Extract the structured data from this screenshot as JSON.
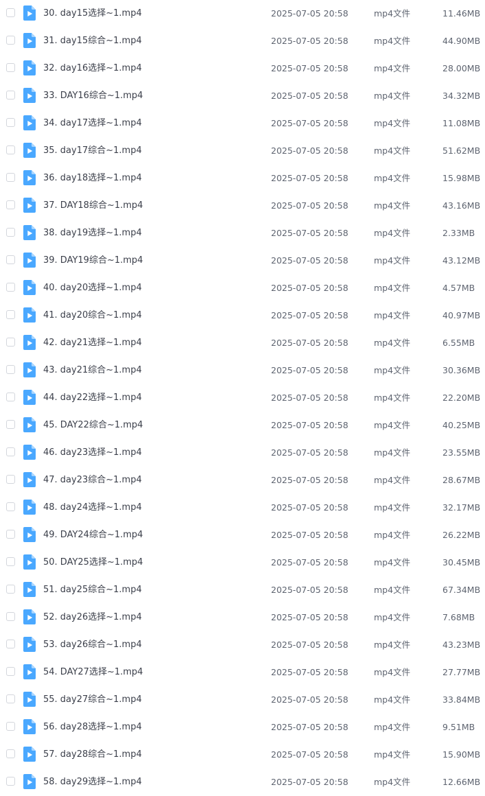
{
  "file_list": {
    "icon": "video-file-icon",
    "icon_color": "#4aa8ff",
    "rows": [
      {
        "name": "30. day15选择~1.mp4",
        "date": "2025-07-05 20:58",
        "type": "mp4文件",
        "size": "11.46MB"
      },
      {
        "name": "31. day15综合~1.mp4",
        "date": "2025-07-05 20:58",
        "type": "mp4文件",
        "size": "44.90MB"
      },
      {
        "name": "32. day16选择~1.mp4",
        "date": "2025-07-05 20:58",
        "type": "mp4文件",
        "size": "28.00MB"
      },
      {
        "name": "33. DAY16综合~1.mp4",
        "date": "2025-07-05 20:58",
        "type": "mp4文件",
        "size": "34.32MB"
      },
      {
        "name": "34. day17选择~1.mp4",
        "date": "2025-07-05 20:58",
        "type": "mp4文件",
        "size": "11.08MB"
      },
      {
        "name": "35. day17综合~1.mp4",
        "date": "2025-07-05 20:58",
        "type": "mp4文件",
        "size": "51.62MB"
      },
      {
        "name": "36. day18选择~1.mp4",
        "date": "2025-07-05 20:58",
        "type": "mp4文件",
        "size": "15.98MB"
      },
      {
        "name": "37. DAY18综合~1.mp4",
        "date": "2025-07-05 20:58",
        "type": "mp4文件",
        "size": "43.16MB"
      },
      {
        "name": "38. day19选择~1.mp4",
        "date": "2025-07-05 20:58",
        "type": "mp4文件",
        "size": "2.33MB"
      },
      {
        "name": "39. DAY19综合~1.mp4",
        "date": "2025-07-05 20:58",
        "type": "mp4文件",
        "size": "43.12MB"
      },
      {
        "name": "40. day20选择~1.mp4",
        "date": "2025-07-05 20:58",
        "type": "mp4文件",
        "size": "4.57MB"
      },
      {
        "name": "41. day20综合~1.mp4",
        "date": "2025-07-05 20:58",
        "type": "mp4文件",
        "size": "40.97MB"
      },
      {
        "name": "42. day21选择~1.mp4",
        "date": "2025-07-05 20:58",
        "type": "mp4文件",
        "size": "6.55MB"
      },
      {
        "name": "43. day21综合~1.mp4",
        "date": "2025-07-05 20:58",
        "type": "mp4文件",
        "size": "30.36MB"
      },
      {
        "name": "44. day22选择~1.mp4",
        "date": "2025-07-05 20:58",
        "type": "mp4文件",
        "size": "22.20MB"
      },
      {
        "name": "45. DAY22综合~1.mp4",
        "date": "2025-07-05 20:58",
        "type": "mp4文件",
        "size": "40.25MB"
      },
      {
        "name": "46. day23选择~1.mp4",
        "date": "2025-07-05 20:58",
        "type": "mp4文件",
        "size": "23.55MB"
      },
      {
        "name": "47. day23综合~1.mp4",
        "date": "2025-07-05 20:58",
        "type": "mp4文件",
        "size": "28.67MB"
      },
      {
        "name": "48. day24选择~1.mp4",
        "date": "2025-07-05 20:58",
        "type": "mp4文件",
        "size": "32.17MB"
      },
      {
        "name": "49. DAY24综合~1.mp4",
        "date": "2025-07-05 20:58",
        "type": "mp4文件",
        "size": "26.22MB"
      },
      {
        "name": "50. DAY25选择~1.mp4",
        "date": "2025-07-05 20:58",
        "type": "mp4文件",
        "size": "30.45MB"
      },
      {
        "name": "51. day25综合~1.mp4",
        "date": "2025-07-05 20:58",
        "type": "mp4文件",
        "size": "67.34MB"
      },
      {
        "name": "52. day26选择~1.mp4",
        "date": "2025-07-05 20:58",
        "type": "mp4文件",
        "size": "7.68MB"
      },
      {
        "name": "53. day26综合~1.mp4",
        "date": "2025-07-05 20:58",
        "type": "mp4文件",
        "size": "43.23MB"
      },
      {
        "name": "54. DAY27选择~1.mp4",
        "date": "2025-07-05 20:58",
        "type": "mp4文件",
        "size": "27.77MB"
      },
      {
        "name": "55. day27综合~1.mp4",
        "date": "2025-07-05 20:58",
        "type": "mp4文件",
        "size": "33.84MB"
      },
      {
        "name": "56. day28选择~1.mp4",
        "date": "2025-07-05 20:58",
        "type": "mp4文件",
        "size": "9.51MB"
      },
      {
        "name": "57. day28综合~1.mp4",
        "date": "2025-07-05 20:58",
        "type": "mp4文件",
        "size": "15.90MB"
      },
      {
        "name": "58. day29选择~1.mp4",
        "date": "2025-07-05 20:58",
        "type": "mp4文件",
        "size": "12.66MB"
      }
    ]
  }
}
